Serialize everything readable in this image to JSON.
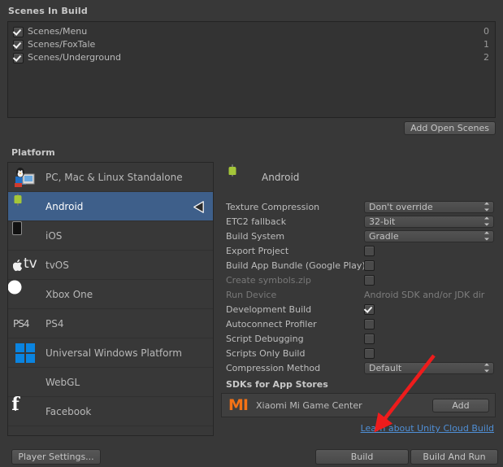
{
  "scenes_section": {
    "header": "Scenes In Build",
    "add_open_scenes_label": "Add Open Scenes",
    "scenes": [
      {
        "name": "Scenes/Menu",
        "index": "0",
        "enabled": true
      },
      {
        "name": "Scenes/FoxTale",
        "index": "1",
        "enabled": true
      },
      {
        "name": "Scenes/Underground",
        "index": "2",
        "enabled": true
      }
    ]
  },
  "platform_section": {
    "header": "Platform",
    "items": [
      {
        "label": "PC, Mac & Linux Standalone",
        "icon": "standalone-icon",
        "selected": false
      },
      {
        "label": "Android",
        "icon": "android-icon",
        "selected": true
      },
      {
        "label": "iOS",
        "icon": "ios-icon",
        "selected": false
      },
      {
        "label": "tvOS",
        "icon": "tvos-icon",
        "selected": false
      },
      {
        "label": "Xbox One",
        "icon": "xbox-icon",
        "selected": false
      },
      {
        "label": "PS4",
        "icon": "ps4-icon",
        "selected": false
      },
      {
        "label": "Universal Windows Platform",
        "icon": "windows-icon",
        "selected": false
      },
      {
        "label": "WebGL",
        "icon": "html5-icon",
        "selected": false
      },
      {
        "label": "Facebook",
        "icon": "facebook-icon",
        "selected": false
      }
    ]
  },
  "settings": {
    "platform_title": "Android",
    "rows": [
      {
        "label": "Texture Compression",
        "type": "popup",
        "value": "Don't override",
        "disabled": false
      },
      {
        "label": "ETC2 fallback",
        "type": "popup",
        "value": "32-bit",
        "disabled": false
      },
      {
        "label": "Build System",
        "type": "popup",
        "value": "Gradle",
        "disabled": false
      },
      {
        "label": "Export Project",
        "type": "checkbox",
        "checked": false,
        "disabled": false
      },
      {
        "label": "Build App Bundle (Google Play)",
        "type": "checkbox",
        "checked": false,
        "disabled": false
      },
      {
        "label": "Create symbols.zip",
        "type": "checkbox",
        "checked": false,
        "disabled": true
      },
      {
        "label": "Run Device",
        "type": "text",
        "value": "Android SDK and/or JDK dir",
        "disabled": true
      },
      {
        "label": "Development Build",
        "type": "checkbox",
        "checked": true,
        "disabled": false
      },
      {
        "label": "Autoconnect Profiler",
        "type": "checkbox",
        "checked": false,
        "disabled": false
      },
      {
        "label": "Script Debugging",
        "type": "checkbox",
        "checked": false,
        "disabled": false
      },
      {
        "label": "Scripts Only Build",
        "type": "checkbox",
        "checked": false,
        "disabled": false
      },
      {
        "label": "Compression Method",
        "type": "popup",
        "value": "Default",
        "disabled": false
      }
    ],
    "sdk_section": {
      "header": "SDKs for App Stores",
      "entry_name": "Xiaomi Mi Game Center",
      "entry_logo": "xiaomi-mi-logo",
      "add_label": "Add"
    },
    "cloud_build_link": "Learn about Unity Cloud Build"
  },
  "bottom_bar": {
    "player_settings_label": "Player Settings...",
    "build_label": "Build",
    "build_and_run_label": "Build And Run"
  },
  "annotation": {
    "arrow_color": "#ee1c1c"
  },
  "colors": {
    "window_bg": "#383838",
    "list_bg": "#333333",
    "selection_blue": "#3e5f8a",
    "link_blue": "#4f8fd6",
    "xiaomi_orange": "#f47216"
  }
}
